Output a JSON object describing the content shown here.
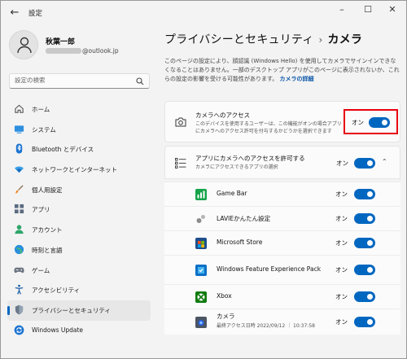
{
  "window": {
    "title": "設定"
  },
  "profile": {
    "name": "秋葉一郎",
    "email_domain": "@outlook.jp"
  },
  "search": {
    "placeholder": "設定の検索"
  },
  "nav": [
    {
      "label": "ホーム",
      "icon": "home-icon"
    },
    {
      "label": "システム",
      "icon": "system-icon"
    },
    {
      "label": "Bluetooth とデバイス",
      "icon": "bluetooth-icon"
    },
    {
      "label": "ネットワークとインターネット",
      "icon": "network-icon"
    },
    {
      "label": "個人用設定",
      "icon": "brush-icon"
    },
    {
      "label": "アプリ",
      "icon": "apps-icon"
    },
    {
      "label": "アカウント",
      "icon": "account-icon"
    },
    {
      "label": "時刻と言語",
      "icon": "time-language-icon"
    },
    {
      "label": "ゲーム",
      "icon": "gaming-icon"
    },
    {
      "label": "アクセシビリティ",
      "icon": "accessibility-icon"
    },
    {
      "label": "プライバシーとセキュリティ",
      "icon": "shield-icon",
      "active": true
    },
    {
      "label": "Windows Update",
      "icon": "windows-update-icon"
    }
  ],
  "header": {
    "parent": "プライバシーとセキュリティ",
    "separator": "›",
    "current": "カメラ"
  },
  "description": {
    "text": "このページの設定により、顔認識 (Windows Hello) を使用してカメラでサインインできなくなることはありません。一部のデスクトップ アプリがこのページに表示されないか、これらの設定の影響を受ける可能性があります。",
    "link": "カメラの詳細"
  },
  "camera_access": {
    "title": "カメラへのアクセス",
    "subtitle_line1": "このデバイスを使用するユーザーは、この機能がオンの場合アプリ",
    "subtitle_line2": "にカメラへのアクセス許可を付与するかどうかを選択できます",
    "state": "オン"
  },
  "app_access": {
    "title": "アプリにカメラへのアクセスを許可する",
    "subtitle": "カメラにアクセスできるアプリの選択",
    "state": "オン"
  },
  "apps": [
    {
      "name": "Game Bar",
      "state": "オン",
      "icon": "game-bar-icon"
    },
    {
      "name": "LAVIEかんたん設定",
      "state": "オン",
      "icon": "lavie-settings-icon"
    },
    {
      "name": "Microsoft Store",
      "state": "オン",
      "icon": "microsoft-store-icon"
    },
    {
      "name": "Windows Feature Experience Pack",
      "state": "オン",
      "icon": "feature-pack-icon"
    },
    {
      "name": "Xbox",
      "state": "オン",
      "icon": "xbox-icon"
    },
    {
      "name": "カメラ",
      "sub": "最終アクセス日時 2022/09/12 ｜ 10:37:58",
      "state": "オン",
      "icon": "camera-app-icon"
    }
  ],
  "colors": {
    "accent": "#0067c0",
    "highlight": "#e8000e"
  }
}
